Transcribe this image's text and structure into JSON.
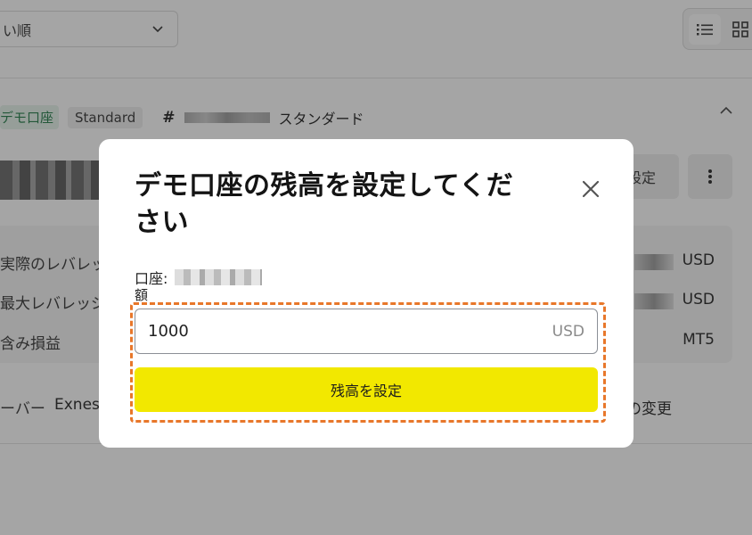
{
  "background": {
    "sort_select": {
      "label": "い順"
    },
    "account": {
      "tag_demo": "デモ口座",
      "tag_type": "Standard",
      "hash": "#",
      "type_name": "スタンダード"
    },
    "settings_button": "設定",
    "info_rows": [
      {
        "label": "実際のレバレッジ",
        "value": "USD"
      },
      {
        "label": "最大レバレッジ",
        "value": "USD"
      },
      {
        "label": "含み損益",
        "value": "MT5"
      }
    ],
    "server_label": "ーバー",
    "server_value": "Exnes",
    "change_link": "の変更"
  },
  "modal": {
    "title": "デモ口座の残高を設定してください",
    "account_label": "口座:",
    "amount_label": "額",
    "amount_value": "1000",
    "currency": "USD",
    "submit_label": "残高を設定"
  },
  "colors": {
    "accent_button": "#f2e800",
    "highlight_border": "#e8772a",
    "demo_tag_bg": "#e5f3ea",
    "demo_tag_text": "#1f7a45"
  },
  "icons": {
    "close": "close-icon",
    "list_view": "list-view-icon",
    "grid_view": "grid-view-icon",
    "chevron_down": "chevron-down-icon",
    "chevron_up": "chevron-up-icon",
    "more": "more-vertical-icon"
  }
}
